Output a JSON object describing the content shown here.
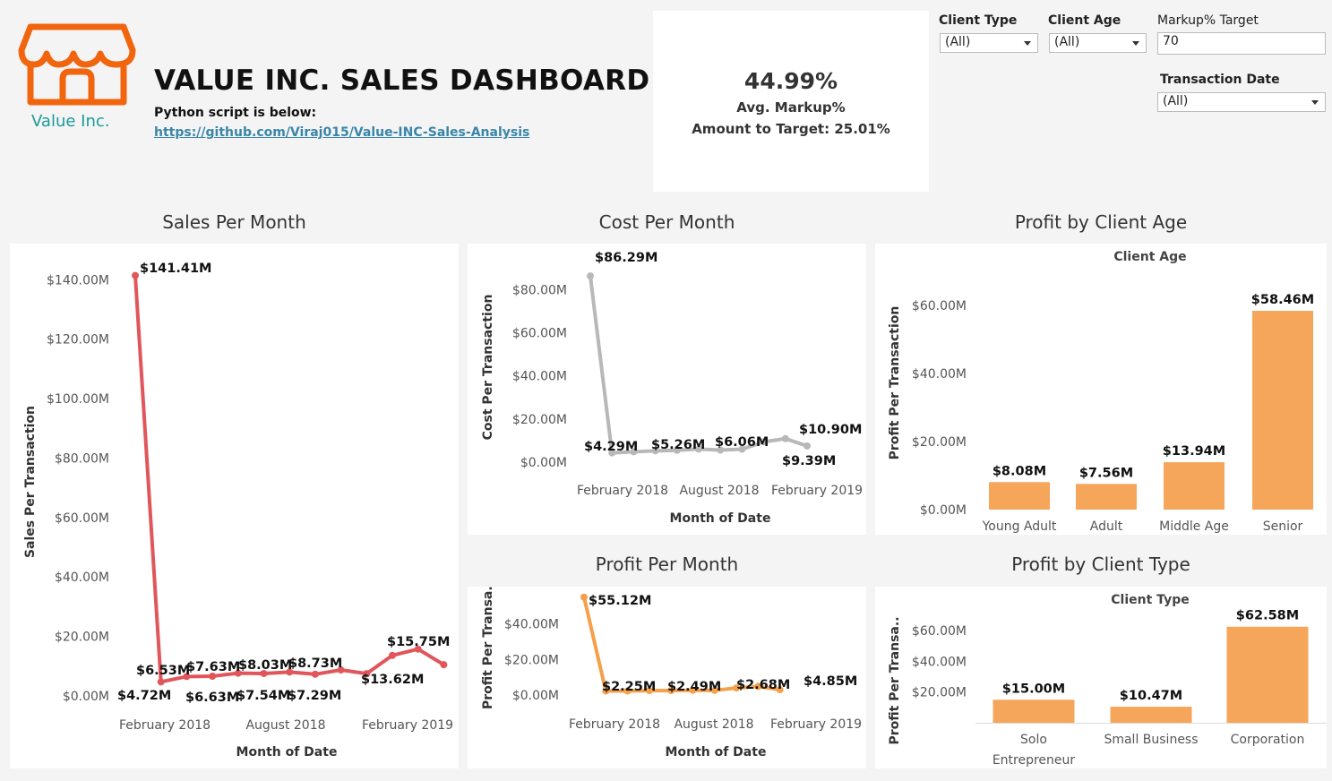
{
  "header": {
    "logo_text": "Value Inc.",
    "title": "VALUE INC. SALES DASHBOARD",
    "script_label": "Python script is below:",
    "script_link": "https://github.com/Viraj015/Value-INC-Sales-Analysis"
  },
  "kpi": {
    "value": "44.99%",
    "label": "Avg. Markup%",
    "target_text": "Amount to Target: 25.01%"
  },
  "filters": {
    "client_type": {
      "label": "Client Type",
      "value": "(All)"
    },
    "client_age": {
      "label": "Client Age",
      "value": "(All)"
    },
    "markup_target": {
      "label": "Markup% Target",
      "value": "70"
    },
    "transaction_date": {
      "label": "Transaction Date",
      "value": "(All)"
    }
  },
  "colors": {
    "sales": "#e0565b",
    "cost": "#b8b8b8",
    "profit": "#f5a04a",
    "bar": "#f5a65b"
  },
  "chart_data": [
    {
      "type": "line",
      "title": "Sales Per Month",
      "xlabel": "Month of Date",
      "ylabel": "Sales Per Transaction",
      "ylim": [
        0,
        144
      ],
      "yticks": [
        "$0.00M",
        "$20.00M",
        "$40.00M",
        "$60.00M",
        "$80.00M",
        "$100.00M",
        "$120.00M",
        "$140.00M"
      ],
      "xticks": [
        "February 2018",
        "August 2018",
        "February 2019"
      ],
      "x": [
        "Jan 2018",
        "Feb 2018",
        "Mar 2018",
        "Apr 2018",
        "May 2018",
        "Jun 2018",
        "Jul 2018",
        "Aug 2018",
        "Sep 2018",
        "Oct 2018",
        "Nov 2018",
        "Dec 2018",
        "Jan 2019",
        "Feb 2019",
        "Mar 2019"
      ],
      "values": [
        141.41,
        4.72,
        6.53,
        6.63,
        7.63,
        7.54,
        8.03,
        7.29,
        8.73,
        7.5,
        13.62,
        15.75,
        10.5
      ],
      "data_labels": [
        "$141.41M",
        "$4.72M",
        "$6.53M",
        "$6.63M",
        "$7.63M",
        "$7.54M",
        "$8.03M",
        "$7.29M",
        "$8.73M",
        "$13.62M",
        "$15.75M"
      ]
    },
    {
      "type": "line",
      "title": "Cost Per Month",
      "xlabel": "Month of Date",
      "ylabel": "Cost Per Transaction",
      "ylim": [
        0,
        88
      ],
      "yticks": [
        "$0.00M",
        "$20.00M",
        "$40.00M",
        "$60.00M",
        "$80.00M"
      ],
      "xticks": [
        "February 2018",
        "August 2018",
        "February 2019"
      ],
      "values": [
        86.29,
        4.29,
        4.8,
        5.26,
        5.5,
        6.06,
        5.6,
        6.0,
        9.39,
        10.9,
        7.5
      ],
      "data_labels": [
        "$86.29M",
        "$4.29M",
        "$5.26M",
        "$6.06M",
        "$10.90M",
        "$9.39M"
      ]
    },
    {
      "type": "line",
      "title": "Profit Per Month",
      "xlabel": "Month of Date",
      "ylabel": "Profit Per Transa..",
      "ylim": [
        0,
        56
      ],
      "yticks": [
        "$0.00M",
        "$20.00M",
        "$40.00M"
      ],
      "xticks": [
        "February 2018",
        "August 2018",
        "February 2019"
      ],
      "values": [
        55.12,
        2.25,
        2.3,
        2.49,
        2.5,
        2.68,
        2.6,
        4.0,
        4.85,
        3.0
      ],
      "data_labels": [
        "$55.12M",
        "$2.25M",
        "$2.49M",
        "$2.68M",
        "$4.85M"
      ]
    },
    {
      "type": "bar",
      "title": "Profit by Client Age",
      "header": "Client Age",
      "ylabel": "Profit Per Transaction",
      "ylim": [
        0,
        64
      ],
      "yticks": [
        "$0.00M",
        "$20.00M",
        "$40.00M",
        "$60.00M"
      ],
      "categories": [
        "Young Adult",
        "Adult",
        "Middle Age",
        "Senior"
      ],
      "values": [
        8.08,
        7.56,
        13.94,
        58.46
      ],
      "data_labels": [
        "$8.08M",
        "$7.56M",
        "$13.94M",
        "$58.46M"
      ]
    },
    {
      "type": "bar",
      "title": "Profit by Client Type",
      "header": "Client Type",
      "ylabel": "Profit Per Transa..",
      "ylim": [
        0,
        70
      ],
      "yticks": [
        "$20.00M",
        "$40.00M",
        "$60.00M"
      ],
      "categories": [
        "Solo Entrepreneur",
        "Small Business",
        "Corporation"
      ],
      "values": [
        15.0,
        10.47,
        62.58
      ],
      "data_labels": [
        "$15.00M",
        "$10.47M",
        "$62.58M"
      ]
    }
  ]
}
